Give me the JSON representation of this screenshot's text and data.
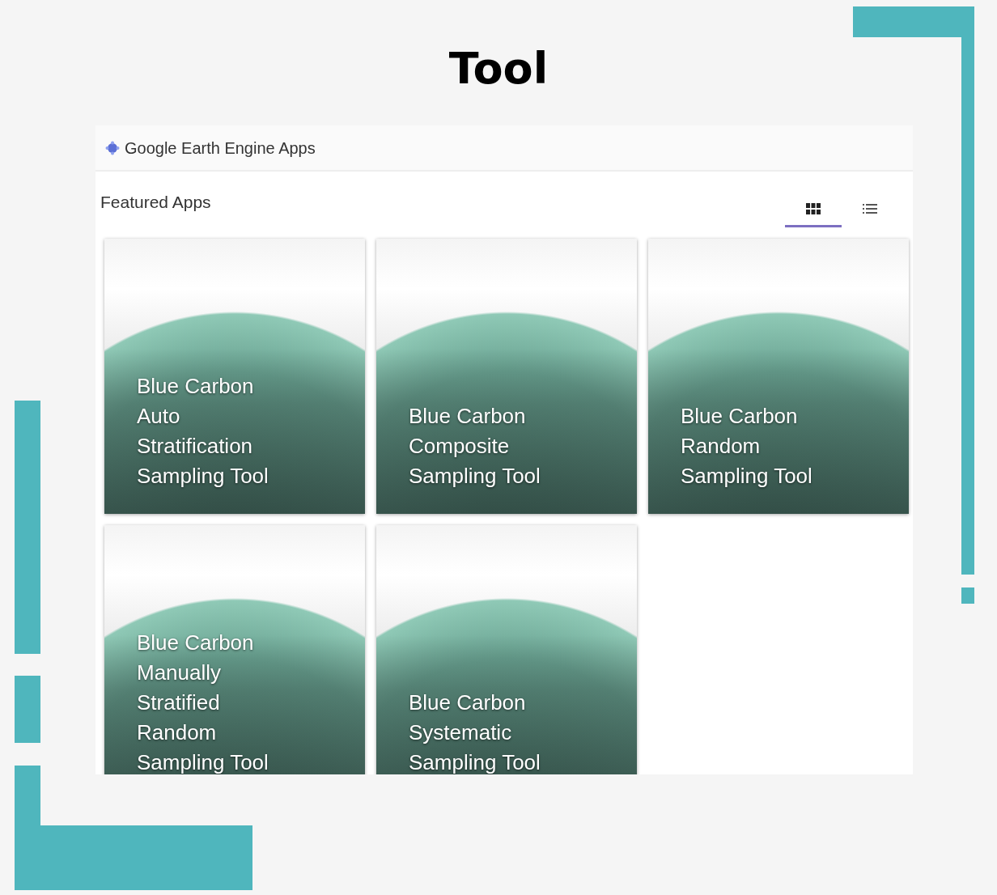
{
  "page_title": "Tool",
  "app_window": {
    "header": {
      "title": "Google Earth Engine Apps"
    },
    "section_title": "Featured Apps",
    "view_toggles": [
      {
        "kind": "grid",
        "selected": true
      },
      {
        "kind": "list",
        "selected": false
      }
    ],
    "apps": [
      {
        "title": "Blue Carbon Auto Stratification Sampling Tool"
      },
      {
        "title": "Blue Carbon Composite Sampling Tool"
      },
      {
        "title": "Blue Carbon Random Sampling Tool"
      },
      {
        "title": "Blue Carbon Manually Stratified Random Sampling Tool"
      },
      {
        "title": "Blue Carbon Systematic Sampling Tool"
      }
    ]
  }
}
